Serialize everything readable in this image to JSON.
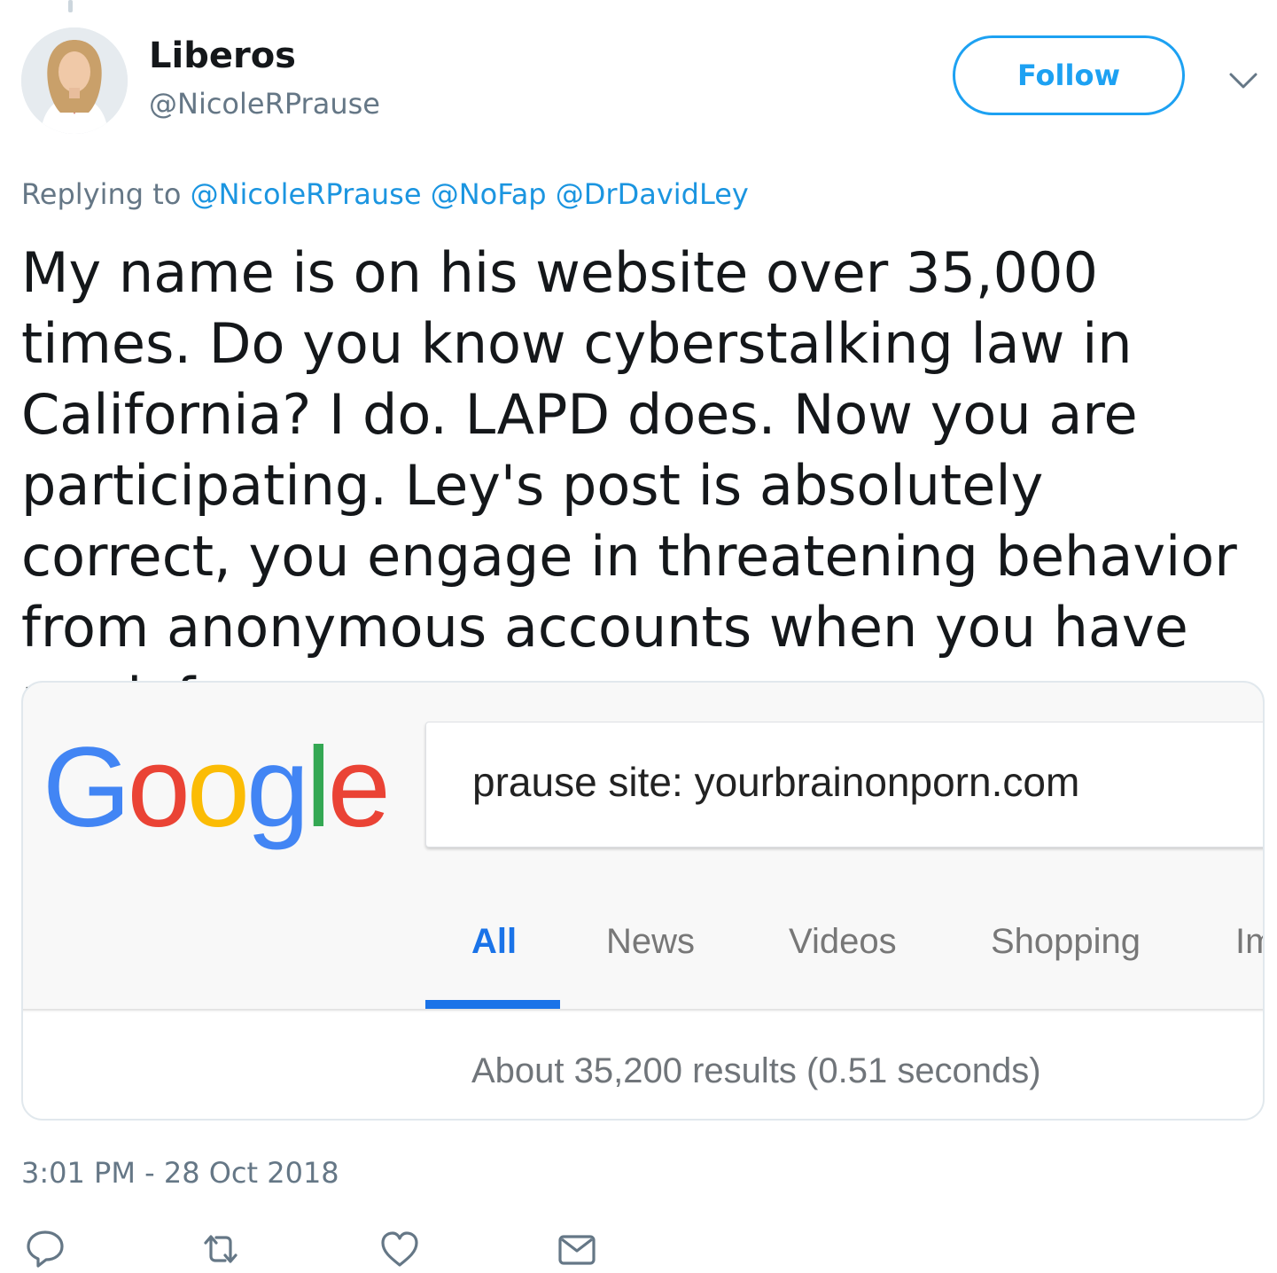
{
  "tweet": {
    "display_name": "Liberos",
    "handle": "@NicoleRPrause",
    "follow_label": "Follow",
    "replying_to_label": "Replying to",
    "replying_to": [
      "@NicoleRPrause",
      "@NoFap",
      "@DrDavidLey"
    ],
    "text": "My name is on his website over 35,000 times. Do you know cyberstalking law in California? I do. LAPD does. Now you are participating. Ley's post is absolutely correct, you engage in threatening behavior from anonymous accounts when you have no defense.",
    "timestamp": "3:01 PM - 28 Oct 2018",
    "actions": [
      "reply-icon",
      "retweet-icon",
      "like-icon",
      "direct-message-icon"
    ]
  },
  "embedded_image": {
    "logo_letters": [
      {
        "char": "G",
        "color": "#4285f4"
      },
      {
        "char": "o",
        "color": "#ea4335"
      },
      {
        "char": "o",
        "color": "#fbbc05"
      },
      {
        "char": "g",
        "color": "#4285f4"
      },
      {
        "char": "l",
        "color": "#34a853"
      },
      {
        "char": "e",
        "color": "#ea4335"
      }
    ],
    "search_query": "prause site: yourbrainonporn.com",
    "tabs": [
      "All",
      "News",
      "Videos",
      "Shopping",
      "Im"
    ],
    "active_tab": "All",
    "result_stats": "About 35,200 results (0.51 seconds)"
  },
  "colors": {
    "twitter_blue": "#1da1f2",
    "mention_blue": "#1b95e0",
    "muted_gray": "#657786",
    "google_blue": "#1a73e8"
  }
}
